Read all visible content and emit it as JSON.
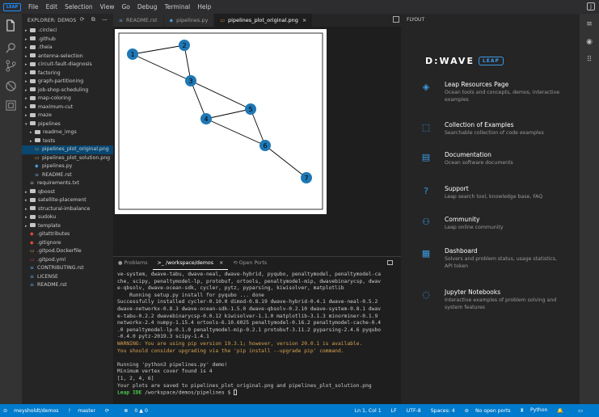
{
  "menubar": {
    "logo": "LEAP",
    "items": [
      "File",
      "Edit",
      "Selection",
      "View",
      "Go",
      "Debug",
      "Terminal",
      "Help"
    ]
  },
  "explorer": {
    "header": "EXPLORER: DEMOS",
    "items": [
      {
        "label": ".circleci",
        "type": "folder",
        "depth": 0,
        "open": false
      },
      {
        "label": ".github",
        "type": "folder",
        "depth": 0,
        "open": false
      },
      {
        "label": ".theia",
        "type": "folder",
        "depth": 0,
        "open": false
      },
      {
        "label": "antenna-selection",
        "type": "folder",
        "depth": 0,
        "open": false
      },
      {
        "label": "circuit-fault-diagnosis",
        "type": "folder",
        "depth": 0,
        "open": false
      },
      {
        "label": "factoring",
        "type": "folder",
        "depth": 0,
        "open": false
      },
      {
        "label": "graph-partitioning",
        "type": "folder",
        "depth": 0,
        "open": false
      },
      {
        "label": "job-shop-scheduling",
        "type": "folder",
        "depth": 0,
        "open": false
      },
      {
        "label": "map-coloring",
        "type": "folder",
        "depth": 0,
        "open": false
      },
      {
        "label": "maximum-cut",
        "type": "folder",
        "depth": 0,
        "open": false
      },
      {
        "label": "maze",
        "type": "folder",
        "depth": 0,
        "open": false
      },
      {
        "label": "pipelines",
        "type": "folder",
        "depth": 0,
        "open": true
      },
      {
        "label": "readme_imgs",
        "type": "folder",
        "depth": 1,
        "open": false
      },
      {
        "label": "tests",
        "type": "folder",
        "depth": 1,
        "open": false
      },
      {
        "label": "pipelines_plot_original.png",
        "type": "image",
        "depth": 1,
        "selected": true
      },
      {
        "label": "pipelines_plot_solution.png",
        "type": "image",
        "depth": 1
      },
      {
        "label": "pipelines.py",
        "type": "python",
        "depth": 1
      },
      {
        "label": "README.rst",
        "type": "rst",
        "depth": 1
      },
      {
        "label": "requirements.txt",
        "type": "txt",
        "depth": 0
      },
      {
        "label": "qboost",
        "type": "folder",
        "depth": 0,
        "open": false
      },
      {
        "label": "satellite-placement",
        "type": "folder",
        "depth": 0,
        "open": false
      },
      {
        "label": "structural-imbalance",
        "type": "folder",
        "depth": 0,
        "open": false
      },
      {
        "label": "sudoku",
        "type": "folder",
        "depth": 0,
        "open": false
      },
      {
        "label": "template",
        "type": "folder",
        "depth": 0,
        "open": false
      },
      {
        "label": ".gitattributes",
        "type": "git",
        "depth": 0
      },
      {
        "label": ".gitignore",
        "type": "git",
        "depth": 0
      },
      {
        "label": ".gitpod.Dockerfile",
        "type": "docker",
        "depth": 0
      },
      {
        "label": ".gitpod.yml",
        "type": "yml",
        "depth": 0
      },
      {
        "label": "CONTRIBUTING.rst",
        "type": "rst",
        "depth": 0
      },
      {
        "label": "LICENSE",
        "type": "license",
        "depth": 0
      },
      {
        "label": "README.rst",
        "type": "rst",
        "depth": 0
      }
    ]
  },
  "tabs": [
    {
      "label": "README.rst",
      "icon": "≡",
      "active": false
    },
    {
      "label": "pipelines.py",
      "icon": "◆",
      "active": false
    },
    {
      "label": "pipelines_plot_original.png",
      "icon": "▭",
      "active": true,
      "close": "×"
    }
  ],
  "graph": {
    "nodes": [
      {
        "id": "1"
      },
      {
        "id": "2"
      },
      {
        "id": "3"
      },
      {
        "id": "4"
      },
      {
        "id": "5"
      },
      {
        "id": "6"
      },
      {
        "id": "7"
      }
    ],
    "edges": [
      [
        "1",
        "2"
      ],
      [
        "1",
        "3"
      ],
      [
        "2",
        "3"
      ],
      [
        "3",
        "4"
      ],
      [
        "3",
        "5"
      ],
      [
        "4",
        "5"
      ],
      [
        "4",
        "6"
      ],
      [
        "5",
        "6"
      ],
      [
        "6",
        "7"
      ]
    ],
    "node_color": "#1f77b4"
  },
  "panel": {
    "tabs": [
      {
        "label": "Problems",
        "icon": "●"
      },
      {
        "label": "/workspace/demos",
        "icon": ">_",
        "active": true,
        "close": "×"
      },
      {
        "label": "Open Ports",
        "icon": "⟲"
      }
    ],
    "terminal_lines": [
      {
        "text": "ve-system, dwave-tabu, dwave-neal, dwave-hybrid, pyqubo, penaltymodel, penaltymodel-ca",
        "kind": "normal"
      },
      {
        "text": "che, scipy, penaltymodel-lp, protobuf, ortools, penaltymodel-mip, dwavebinarycsp, dwav",
        "kind": "normal"
      },
      {
        "text": "e-qbsolv, dwave-ocean-sdk, cycler, pytz, pyparsing, kiwisolver, matplotlib",
        "kind": "normal"
      },
      {
        "text": "    Running setup.py install for pyqubo ... done",
        "kind": "normal"
      },
      {
        "text": "Successfully installed cycler-0.10.0 dimod-0.8.19 dwave-hybrid-0.4.1 dwave-neal-0.5.2",
        "kind": "normal"
      },
      {
        "text": "dwave-networkx-0.8.3 dwave-ocean-sdk-1.5.0 dwave-qbsolv-0.2.10 dwave-system-0.8.1 dwav",
        "kind": "normal"
      },
      {
        "text": "e-tabu-0.2.2 dwavebinarycsp-0.0.12 kiwisolver-1.1.0 matplotlib-3.1.3 minorminer-0.1.9",
        "kind": "normal"
      },
      {
        "text": "networkx-2.4 numpy-1.15.4 ortools-6.10.6025 penaltymodel-0.16.2 penaltymodel-cache-0.4",
        "kind": "normal"
      },
      {
        "text": ".0 penaltymodel-lp-0.1.0 penaltymodel-mip-0.2.1 protobuf-3.11.2 pyparsing-2.4.6 pyqubo",
        "kind": "normal"
      },
      {
        "text": "-0.4.0 pytz-2019.3 scipy-1.4.1",
        "kind": "normal"
      },
      {
        "text": "WARNING: You are using pip version 19.3.1; however, version 20.0.1 is available.",
        "kind": "warn"
      },
      {
        "text": "You should consider upgrading via the 'pip install --upgrade pip' command.",
        "kind": "warn"
      },
      {
        "text": "",
        "kind": "normal"
      },
      {
        "text": "Running 'python3 pipelines.py' demo!",
        "kind": "normal"
      },
      {
        "text": "Minimum vertex cover found is 4",
        "kind": "normal"
      },
      {
        "text": "[1, 2, 4, 6]",
        "kind": "normal"
      },
      {
        "text": "Your plots are saved to pipelines_plot_original.png and pipelines_plot_solution.png",
        "kind": "normal"
      }
    ],
    "prompt_name": "Leap IDE",
    "prompt_path": " /workspace/demos/pipelines $ "
  },
  "flyout": {
    "title": "FLYOUT",
    "brand": "D:WAVE",
    "brand_badge": "LEAP",
    "items": [
      {
        "title": "Leap Resources Page",
        "sub": "Ocean tools and concepts, demos, interactive examples",
        "icon": "◈"
      },
      {
        "title": "Collection of Examples",
        "sub": "Searchable collection of code examples",
        "icon": "⬚"
      },
      {
        "title": "Documentation",
        "sub": "Ocean software documents",
        "icon": "▤"
      },
      {
        "title": "Support",
        "sub": "Leap search tool, knowledge base, FAQ",
        "icon": "?"
      },
      {
        "title": "Community",
        "sub": "Leap online community",
        "icon": "⚇"
      },
      {
        "title": "Dashboard",
        "sub": "Solvers and problem status, usage statistics, API token",
        "icon": "▦"
      },
      {
        "title": "Jupyter Notebooks",
        "sub": "Interactive examples of problem solving and system features",
        "icon": "◌"
      }
    ]
  },
  "statusbar": {
    "left": [
      {
        "label": "meysholdt/demos",
        "icon": "⊙"
      },
      {
        "label": "master",
        "icon": "ᚹ"
      },
      {
        "label": "",
        "icon": "⟳"
      },
      {
        "label": "0 ▲ 0",
        "icon": "⊗"
      }
    ],
    "right": [
      {
        "label": "Ln 1, Col 1"
      },
      {
        "label": "LF"
      },
      {
        "label": "UTF-8"
      },
      {
        "label": "Spaces: 4"
      },
      {
        "label": "No open ports",
        "icon": "⊘"
      },
      {
        "label": "Python",
        "icon": "⧗"
      },
      {
        "label": "",
        "icon": "🔔"
      },
      {
        "label": "",
        "icon": "▭"
      }
    ]
  }
}
